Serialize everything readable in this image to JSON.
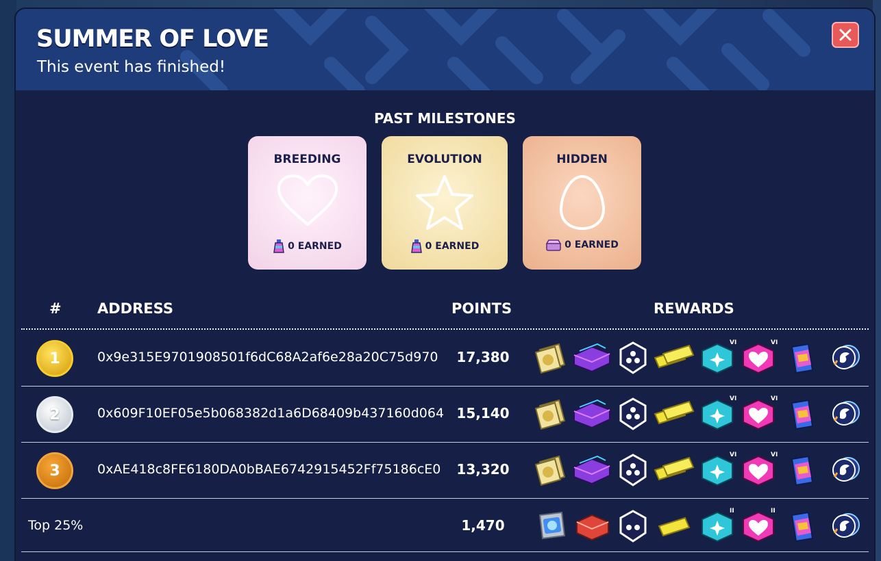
{
  "header": {
    "title": "SUMMER OF LOVE",
    "subtitle": "This event has finished!"
  },
  "milestones": {
    "section_title": "PAST MILESTONES",
    "items": [
      {
        "label": "BREEDING",
        "shape": "heart-outline-icon",
        "reward_icon": "potion-icon",
        "earned": "0 EARNED"
      },
      {
        "label": "EVOLUTION",
        "shape": "star-outline-icon",
        "reward_icon": "potion-icon",
        "earned": "0 EARNED"
      },
      {
        "label": "HIDDEN",
        "shape": "egg-outline-icon",
        "reward_icon": "chest-icon",
        "earned": "0 EARNED"
      }
    ]
  },
  "table": {
    "headers": {
      "rank": "#",
      "address": "ADDRESS",
      "points": "POINTS",
      "rewards": "REWARDS"
    },
    "rows": [
      {
        "rank": "1",
        "address": "0x9e315E9701908501f6dC68A2af6e28a20C75d970",
        "points": "17,380"
      },
      {
        "rank": "2",
        "address": "0x609F10EF05e5b068382d1a6D68409b437160d064",
        "points": "15,140"
      },
      {
        "rank": "3",
        "address": "0xAE418c8FE6180DA0bBAE6742915452Ff75186cE0",
        "points": "13,320"
      },
      {
        "rank": "Top 25%",
        "address": "",
        "points": "1,470"
      }
    ],
    "reward_icons": [
      "gold-card-pack-icon",
      "purple-chest-icon",
      "star-badge-icon",
      "gold-ticket-icon",
      "cyan-sparkle-box-icon",
      "pink-heart-box-icon",
      "potion-pack-icon",
      "unicorn-token-icon"
    ],
    "reward_levels": {
      "top": "VI",
      "top25": "II"
    }
  },
  "colors": {
    "modal_bg": "#161f45",
    "header_bg": "#1f3c7a",
    "close": "#e85a5a",
    "gold": "#f7cc2e",
    "silver": "#e7ecf1",
    "bronze": "#f0a63c"
  }
}
